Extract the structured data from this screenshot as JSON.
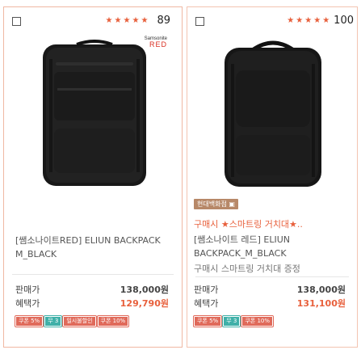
{
  "products": [
    {
      "rating_count": "89",
      "stars": 5,
      "brand_logo": {
        "line1": "Samsonite",
        "line2": "RED"
      },
      "name": "[쌤소나이트RED] ELIUN BACKPACK M_BLACK",
      "price_label": "판매가",
      "price": "138,000원",
      "benefit_label": "혜택가",
      "benefit_price": "129,790원",
      "coupons": [
        "쿠폰 5%",
        "무 3",
        "일시불할인",
        "쿠폰 10%"
      ]
    },
    {
      "rating_count": "100",
      "stars": 5,
      "badge": "현대백화점 ▣",
      "promo": "구매시 ★스마트링 거치대★..",
      "name": "[쌤소나이트 레드] ELIUN BACKPACK_M_BLACK",
      "subtitle": "구매시 스마트링 거치대 증정",
      "price_label": "판매가",
      "price": "138,000원",
      "benefit_label": "혜택가",
      "benefit_price": "131,100원",
      "coupons": [
        "쿠폰 5%",
        "무 3",
        "쿠폰 10%"
      ]
    }
  ],
  "colors": {
    "accent": "#e8603c",
    "border": "#f0b8a3"
  }
}
